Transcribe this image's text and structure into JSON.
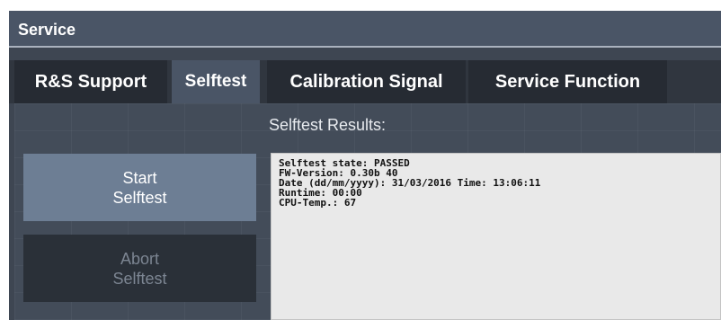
{
  "window": {
    "title": "Service"
  },
  "tabs": [
    {
      "label": "R&S Support",
      "active": false
    },
    {
      "label": "Selftest",
      "active": true
    },
    {
      "label": "Calibration Signal",
      "active": false
    },
    {
      "label": "Service Function",
      "active": false
    }
  ],
  "selftest": {
    "results_label": "Selftest Results:",
    "start_button": {
      "line1": "Start",
      "line2": "Selftest"
    },
    "abort_button": {
      "line1": "Abort",
      "line2": "Selftest",
      "enabled": false
    },
    "results_lines": [
      "Selftest state: PASSED",
      "FW-Version: 0.30b 40",
      "Date (dd/mm/yyyy): 31/03/2016 Time: 13:06:11",
      "Runtime: 00:00",
      "CPU-Temp.: 67"
    ]
  },
  "colors": {
    "title_bar": "#4a5566",
    "active_tab": "#4a5566",
    "inactive_tab": "#262b33",
    "start_button": "#6d7e94",
    "abort_button_disabled": "#2a3038",
    "results_background": "#e9e9e9"
  }
}
